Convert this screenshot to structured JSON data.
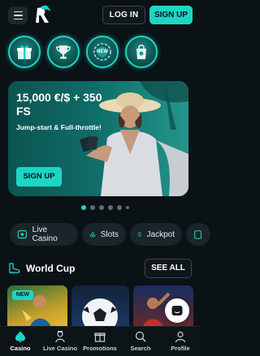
{
  "header": {
    "login_label": "LOG IN",
    "signup_label": "SIGN UP"
  },
  "promos": [
    {
      "icon": "gift-box-icon"
    },
    {
      "icon": "trophy-icon"
    },
    {
      "icon": "new-chip-icon",
      "text": "NEW"
    },
    {
      "icon": "shopping-bag-icon"
    }
  ],
  "banner": {
    "title": "15,000 €/$ + 350 FS",
    "subtitle": "Jump-start & Full-throttle!",
    "cta_label": "SIGN UP",
    "slides_total": 6,
    "active_slide": 1
  },
  "categories": [
    {
      "label": "Live Casino",
      "icon": "live-casino-icon"
    },
    {
      "label": "Slots",
      "icon": "cherries-icon"
    },
    {
      "label": "Jackpot",
      "icon": "jackpot-icon"
    }
  ],
  "section": {
    "title": "World Cup",
    "see_all_label": "SEE ALL",
    "new_badge": "NEW"
  },
  "nav": [
    {
      "label": "Casino",
      "icon": "casino-icon",
      "active": true
    },
    {
      "label": "Live Casino",
      "icon": "dealer-icon"
    },
    {
      "label": "Promotions",
      "icon": "gift-icon"
    },
    {
      "label": "Search",
      "icon": "search-icon"
    },
    {
      "label": "Profile",
      "icon": "profile-icon"
    }
  ],
  "colors": {
    "accent": "#1ed5c5",
    "background": "#0b1216"
  }
}
